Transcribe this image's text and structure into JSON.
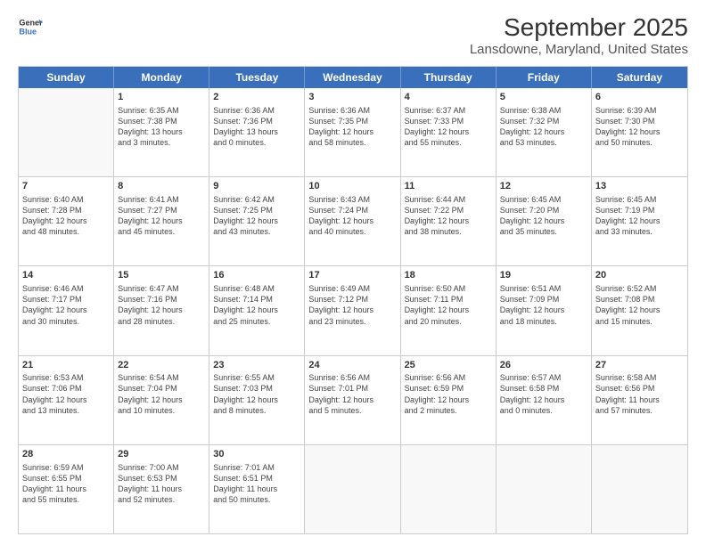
{
  "header": {
    "logo_line1": "General",
    "logo_line2": "Blue",
    "title": "September 2025",
    "subtitle": "Lansdowne, Maryland, United States"
  },
  "days": [
    "Sunday",
    "Monday",
    "Tuesday",
    "Wednesday",
    "Thursday",
    "Friday",
    "Saturday"
  ],
  "weeks": [
    [
      {
        "day": "",
        "content": ""
      },
      {
        "day": "1",
        "content": "Sunrise: 6:35 AM\nSunset: 7:38 PM\nDaylight: 13 hours\nand 3 minutes."
      },
      {
        "day": "2",
        "content": "Sunrise: 6:36 AM\nSunset: 7:36 PM\nDaylight: 13 hours\nand 0 minutes."
      },
      {
        "day": "3",
        "content": "Sunrise: 6:36 AM\nSunset: 7:35 PM\nDaylight: 12 hours\nand 58 minutes."
      },
      {
        "day": "4",
        "content": "Sunrise: 6:37 AM\nSunset: 7:33 PM\nDaylight: 12 hours\nand 55 minutes."
      },
      {
        "day": "5",
        "content": "Sunrise: 6:38 AM\nSunset: 7:32 PM\nDaylight: 12 hours\nand 53 minutes."
      },
      {
        "day": "6",
        "content": "Sunrise: 6:39 AM\nSunset: 7:30 PM\nDaylight: 12 hours\nand 50 minutes."
      }
    ],
    [
      {
        "day": "7",
        "content": "Sunrise: 6:40 AM\nSunset: 7:28 PM\nDaylight: 12 hours\nand 48 minutes."
      },
      {
        "day": "8",
        "content": "Sunrise: 6:41 AM\nSunset: 7:27 PM\nDaylight: 12 hours\nand 45 minutes."
      },
      {
        "day": "9",
        "content": "Sunrise: 6:42 AM\nSunset: 7:25 PM\nDaylight: 12 hours\nand 43 minutes."
      },
      {
        "day": "10",
        "content": "Sunrise: 6:43 AM\nSunset: 7:24 PM\nDaylight: 12 hours\nand 40 minutes."
      },
      {
        "day": "11",
        "content": "Sunrise: 6:44 AM\nSunset: 7:22 PM\nDaylight: 12 hours\nand 38 minutes."
      },
      {
        "day": "12",
        "content": "Sunrise: 6:45 AM\nSunset: 7:20 PM\nDaylight: 12 hours\nand 35 minutes."
      },
      {
        "day": "13",
        "content": "Sunrise: 6:45 AM\nSunset: 7:19 PM\nDaylight: 12 hours\nand 33 minutes."
      }
    ],
    [
      {
        "day": "14",
        "content": "Sunrise: 6:46 AM\nSunset: 7:17 PM\nDaylight: 12 hours\nand 30 minutes."
      },
      {
        "day": "15",
        "content": "Sunrise: 6:47 AM\nSunset: 7:16 PM\nDaylight: 12 hours\nand 28 minutes."
      },
      {
        "day": "16",
        "content": "Sunrise: 6:48 AM\nSunset: 7:14 PM\nDaylight: 12 hours\nand 25 minutes."
      },
      {
        "day": "17",
        "content": "Sunrise: 6:49 AM\nSunset: 7:12 PM\nDaylight: 12 hours\nand 23 minutes."
      },
      {
        "day": "18",
        "content": "Sunrise: 6:50 AM\nSunset: 7:11 PM\nDaylight: 12 hours\nand 20 minutes."
      },
      {
        "day": "19",
        "content": "Sunrise: 6:51 AM\nSunset: 7:09 PM\nDaylight: 12 hours\nand 18 minutes."
      },
      {
        "day": "20",
        "content": "Sunrise: 6:52 AM\nSunset: 7:08 PM\nDaylight: 12 hours\nand 15 minutes."
      }
    ],
    [
      {
        "day": "21",
        "content": "Sunrise: 6:53 AM\nSunset: 7:06 PM\nDaylight: 12 hours\nand 13 minutes."
      },
      {
        "day": "22",
        "content": "Sunrise: 6:54 AM\nSunset: 7:04 PM\nDaylight: 12 hours\nand 10 minutes."
      },
      {
        "day": "23",
        "content": "Sunrise: 6:55 AM\nSunset: 7:03 PM\nDaylight: 12 hours\nand 8 minutes."
      },
      {
        "day": "24",
        "content": "Sunrise: 6:56 AM\nSunset: 7:01 PM\nDaylight: 12 hours\nand 5 minutes."
      },
      {
        "day": "25",
        "content": "Sunrise: 6:56 AM\nSunset: 6:59 PM\nDaylight: 12 hours\nand 2 minutes."
      },
      {
        "day": "26",
        "content": "Sunrise: 6:57 AM\nSunset: 6:58 PM\nDaylight: 12 hours\nand 0 minutes."
      },
      {
        "day": "27",
        "content": "Sunrise: 6:58 AM\nSunset: 6:56 PM\nDaylight: 11 hours\nand 57 minutes."
      }
    ],
    [
      {
        "day": "28",
        "content": "Sunrise: 6:59 AM\nSunset: 6:55 PM\nDaylight: 11 hours\nand 55 minutes."
      },
      {
        "day": "29",
        "content": "Sunrise: 7:00 AM\nSunset: 6:53 PM\nDaylight: 11 hours\nand 52 minutes."
      },
      {
        "day": "30",
        "content": "Sunrise: 7:01 AM\nSunset: 6:51 PM\nDaylight: 11 hours\nand 50 minutes."
      },
      {
        "day": "",
        "content": ""
      },
      {
        "day": "",
        "content": ""
      },
      {
        "day": "",
        "content": ""
      },
      {
        "day": "",
        "content": ""
      }
    ]
  ]
}
